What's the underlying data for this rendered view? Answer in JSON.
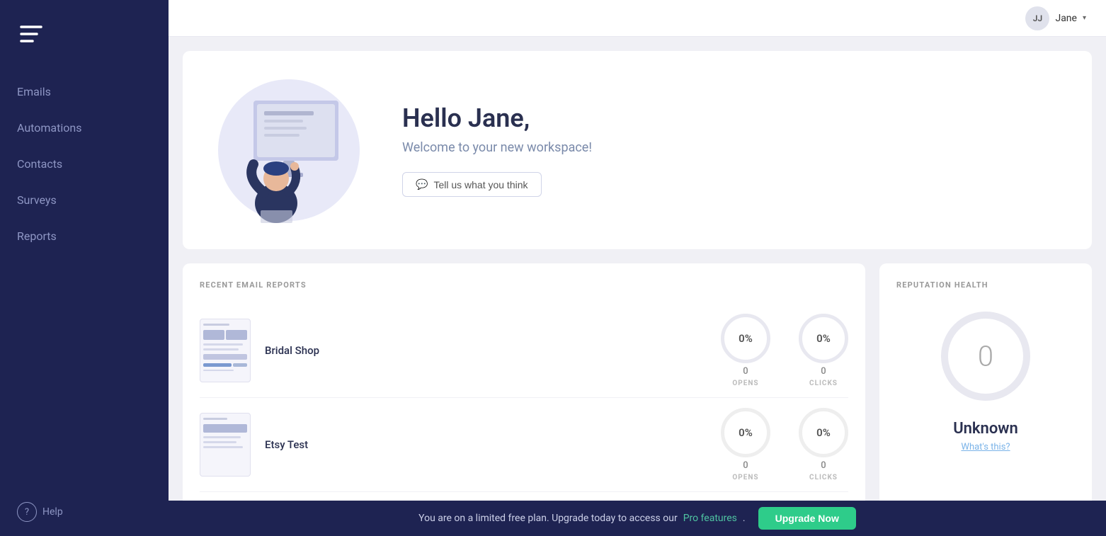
{
  "sidebar": {
    "logo_alt": "App Logo",
    "nav_items": [
      {
        "label": "Emails",
        "id": "emails"
      },
      {
        "label": "Automations",
        "id": "automations"
      },
      {
        "label": "Contacts",
        "id": "contacts"
      },
      {
        "label": "Surveys",
        "id": "surveys"
      },
      {
        "label": "Reports",
        "id": "reports"
      }
    ],
    "help_label": "Help"
  },
  "topbar": {
    "user_initials": "JJ",
    "user_name": "Jane"
  },
  "welcome": {
    "greeting": "Hello Jane,",
    "subtitle": "Welcome to your new workspace!",
    "feedback_btn": "Tell us what you think"
  },
  "recent_reports": {
    "section_title": "RECENT EMAIL REPORTS",
    "items": [
      {
        "name": "Bridal Shop",
        "opens_pct": "0%",
        "opens_count": "0",
        "opens_label": "OPENS",
        "clicks_pct": "0%",
        "clicks_count": "0",
        "clicks_label": "CLICKS"
      },
      {
        "name": "Etsy Test",
        "opens_pct": "0%",
        "opens_count": "0",
        "opens_label": "OPENS",
        "clicks_pct": "0%",
        "clicks_count": "0",
        "clicks_label": "CLICKS"
      }
    ]
  },
  "reputation": {
    "section_title": "REPUTATION HEALTH",
    "value": "0",
    "status": "Unknown",
    "whats_this": "What's this?"
  },
  "upgrade_bar": {
    "message": "You are on a limited free plan. Upgrade today to access our",
    "link_text": "Pro features",
    "link_suffix": ".",
    "button_label": "Upgrade Now"
  }
}
